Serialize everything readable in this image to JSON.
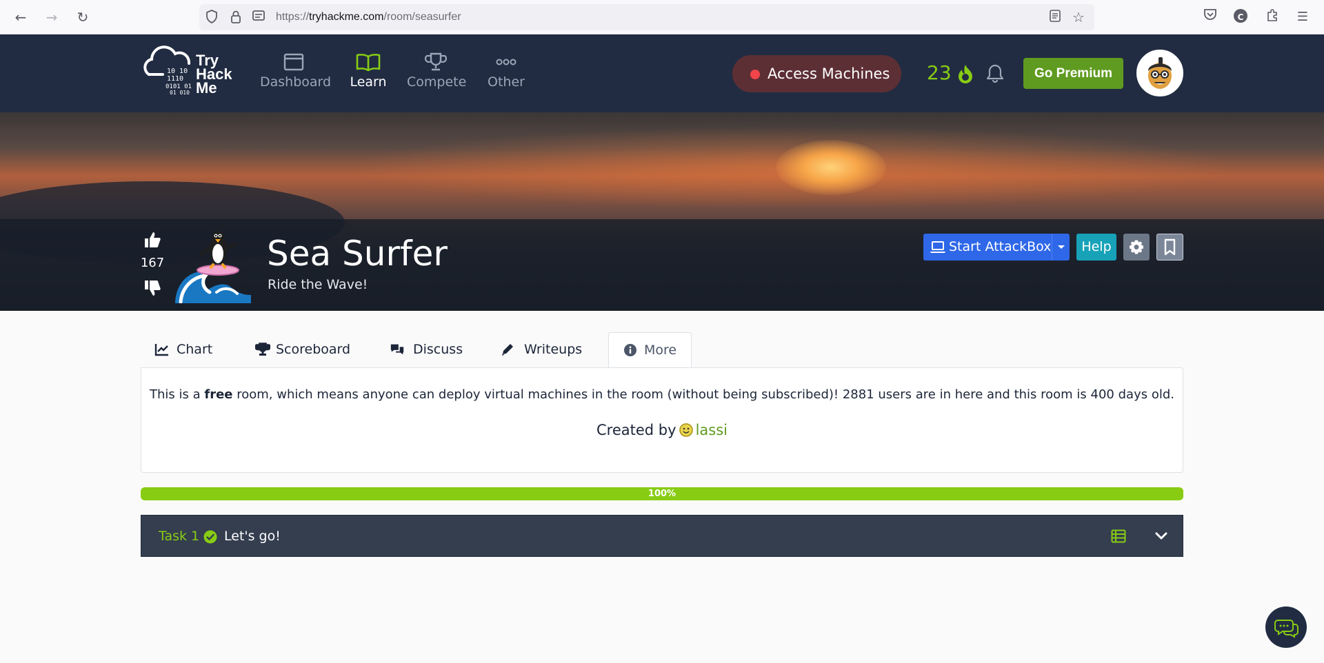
{
  "browser": {
    "url_prefix": "https://",
    "url_domain": "tryhackme.com",
    "url_path": "/room/seasurfer",
    "profile_initial": "C"
  },
  "navbar": {
    "logo_lines": [
      "Try",
      "Hack",
      "Me"
    ],
    "items": [
      {
        "label": "Dashboard",
        "icon": "dashboard-icon"
      },
      {
        "label": "Learn",
        "icon": "book-icon",
        "active": true
      },
      {
        "label": "Compete",
        "icon": "trophy-icon"
      },
      {
        "label": "Other",
        "icon": "more-dots-icon"
      }
    ],
    "access_machines": "Access Machines",
    "streak": "23",
    "go_premium": "Go Premium"
  },
  "room": {
    "title": "Sea Surfer",
    "subtitle": "Ride the Wave!",
    "votes": "167",
    "start_attackbox": "Start AttackBox",
    "help": "Help"
  },
  "tabs": [
    {
      "label": "Chart",
      "icon": "line-chart-icon"
    },
    {
      "label": "Scoreboard",
      "icon": "trophy-icon"
    },
    {
      "label": "Discuss",
      "icon": "comments-icon"
    },
    {
      "label": "Writeups",
      "icon": "pencil-icon"
    },
    {
      "label": "More",
      "icon": "info-icon",
      "active": true
    }
  ],
  "info": {
    "text_before": "This is a ",
    "text_bold": "free",
    "text_after": " room, which means anyone can deploy virtual machines in the room (without being subscribed)! 2881 users are in here and this room is 400 days old.",
    "created_by": "Created by",
    "author": "lassi"
  },
  "progress": {
    "label": "100%",
    "value": 1.0
  },
  "task": {
    "number": "Task 1",
    "title": "Let's go!"
  },
  "colors": {
    "accent_green": "#88cc14",
    "nav_bg": "#212c42",
    "attackbox_blue": "#2e67e8",
    "help_teal": "#17a2b8",
    "access_red": "#f2454b"
  }
}
